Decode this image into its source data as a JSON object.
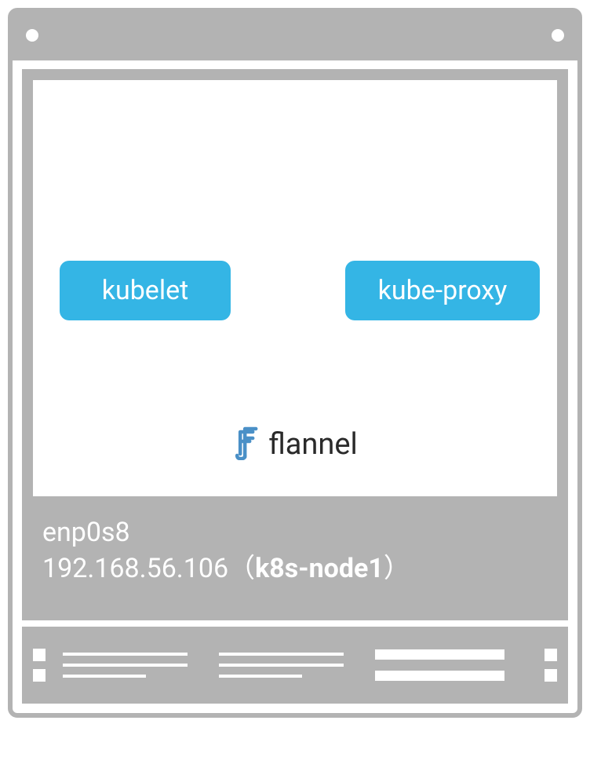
{
  "components": {
    "left": "kubelet",
    "right": "kube-proxy",
    "networking": "flannel"
  },
  "interface": {
    "name": "enp0s8",
    "ip": "192.168.56.106",
    "hostname": "k8s-node1"
  }
}
